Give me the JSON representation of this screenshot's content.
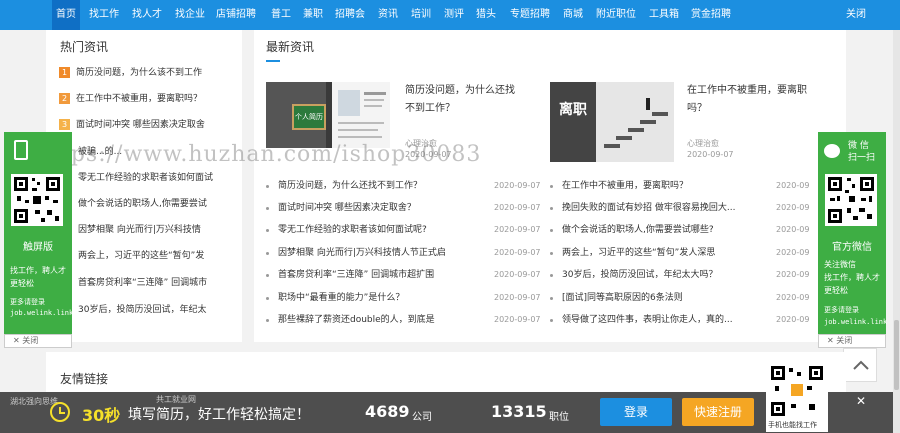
{
  "nav": {
    "items": [
      "首页",
      "找工作",
      "找人才",
      "找企业",
      "店铺招聘",
      "普工",
      "兼职",
      "招聘会",
      "资讯",
      "培训",
      "测评",
      "猎头",
      "专题招聘",
      "商城",
      "附近职位",
      "工具箱",
      "赏金招聘"
    ],
    "close": "关闭"
  },
  "hot": {
    "title": "热门资讯",
    "items": [
      {
        "rank": "1",
        "text": "简历没问题，为什么该不到工作"
      },
      {
        "rank": "2",
        "text": "在工作中不被重用，要离职吗？"
      },
      {
        "rank": "3",
        "text": "面试时间冲突 哪些因素决定取舍"
      },
      {
        "rank": "",
        "text": "被骗...的..."
      },
      {
        "rank": "",
        "text": "零无工作经验的求职者该如何面试"
      },
      {
        "rank": "",
        "text": "做个会说话的职场人,你需要尝试"
      },
      {
        "rank": "",
        "text": "因梦相聚 向光而行|万兴科技情"
      },
      {
        "rank": "",
        "text": "两会上，习近平的这些“暂句”发"
      },
      {
        "rank": "",
        "text": "首套房贷利率“三连降” 回调城市"
      },
      {
        "rank": "",
        "text": "30岁后，投简历没回试，年纪太"
      }
    ]
  },
  "latest": {
    "title": "最新资讯",
    "featured": [
      {
        "title": "简历没问题，为什么还找不到工作？",
        "tag": "心理治愈",
        "date": "2020-09-07",
        "img_caption": "个人简历"
      },
      {
        "title": "在工作中不被重用，要离职吗？",
        "tag": "心理治愈",
        "date": "2020-09-07",
        "img_caption": "离职"
      }
    ],
    "left_list": [
      {
        "title": "简历没问题，为什么还找不到工作？",
        "date": "2020-09-07"
      },
      {
        "title": "面试时间冲突 哪些因素决定取舍？",
        "date": "2020-09-07"
      },
      {
        "title": "零无工作经验的求职者该如何面试呢?",
        "date": "2020-09-07"
      },
      {
        "title": "因梦相聚 向光而行|万兴科技情人节正式启",
        "date": "2020-09-07"
      },
      {
        "title": "首套房贷利率“三连降” 回调城市超扩围",
        "date": "2020-09-07"
      },
      {
        "title": "职场中“最看重的能力”是什么？",
        "date": "2020-09-07"
      },
      {
        "title": "那些裸辞了薪资还double的人，到底是",
        "date": "2020-09-07"
      }
    ],
    "right_list": [
      {
        "title": "在工作中不被重用，要离职吗？",
        "date": "2020-09"
      },
      {
        "title": "挽回失败的面试有妙招 做牢很容易挽回大...",
        "date": "2020-09"
      },
      {
        "title": "做个会说话的职场人,你需要尝试哪些?",
        "date": "2020-09"
      },
      {
        "title": "两会上，习近平的这些“暂句”发人深思",
        "date": "2020-09"
      },
      {
        "title": "30岁后，投简历没回试，年纪太大吗？",
        "date": "2020-09"
      },
      {
        "title": "[面试]同等高职原因的6条法则",
        "date": "2020-09"
      },
      {
        "title": "领导做了这四件事，表明让你走人，真的...",
        "date": "2020-09"
      }
    ]
  },
  "watermark": "https://www.huzhan.com/ishop30083",
  "side_left": {
    "label": "触屏版",
    "text": [
      "找工作，聘人才",
      "更轻松"
    ],
    "login": "更多请登录",
    "site": "job.welink.link",
    "close": "关闭"
  },
  "side_right": {
    "header": [
      "微 信",
      "扫一扫"
    ],
    "label": "官方微信",
    "text": [
      "关注微信",
      "找工作，聘人才",
      "更轻松"
    ],
    "login": "更多请登录",
    "site": "job.welink.link",
    "close": "关闭"
  },
  "friend_links": {
    "title": "友情链接",
    "items": [
      "湖北强向思维",
      "共工就业网"
    ]
  },
  "bottom": {
    "highlight": "30秒",
    "slogan": "填写简历，好工作轻松搞定！",
    "companies_count": "4689",
    "companies_label": "公司",
    "jobs_count": "13315",
    "jobs_label": "职位",
    "login": "登录",
    "register": "快速注册",
    "app": "手机也能找工作"
  },
  "colors": {
    "nav": "#1c8fe0",
    "green": "#3eae44",
    "login": "#1c8fe0",
    "register": "#f5a623",
    "highlight": "#f5e02a"
  }
}
